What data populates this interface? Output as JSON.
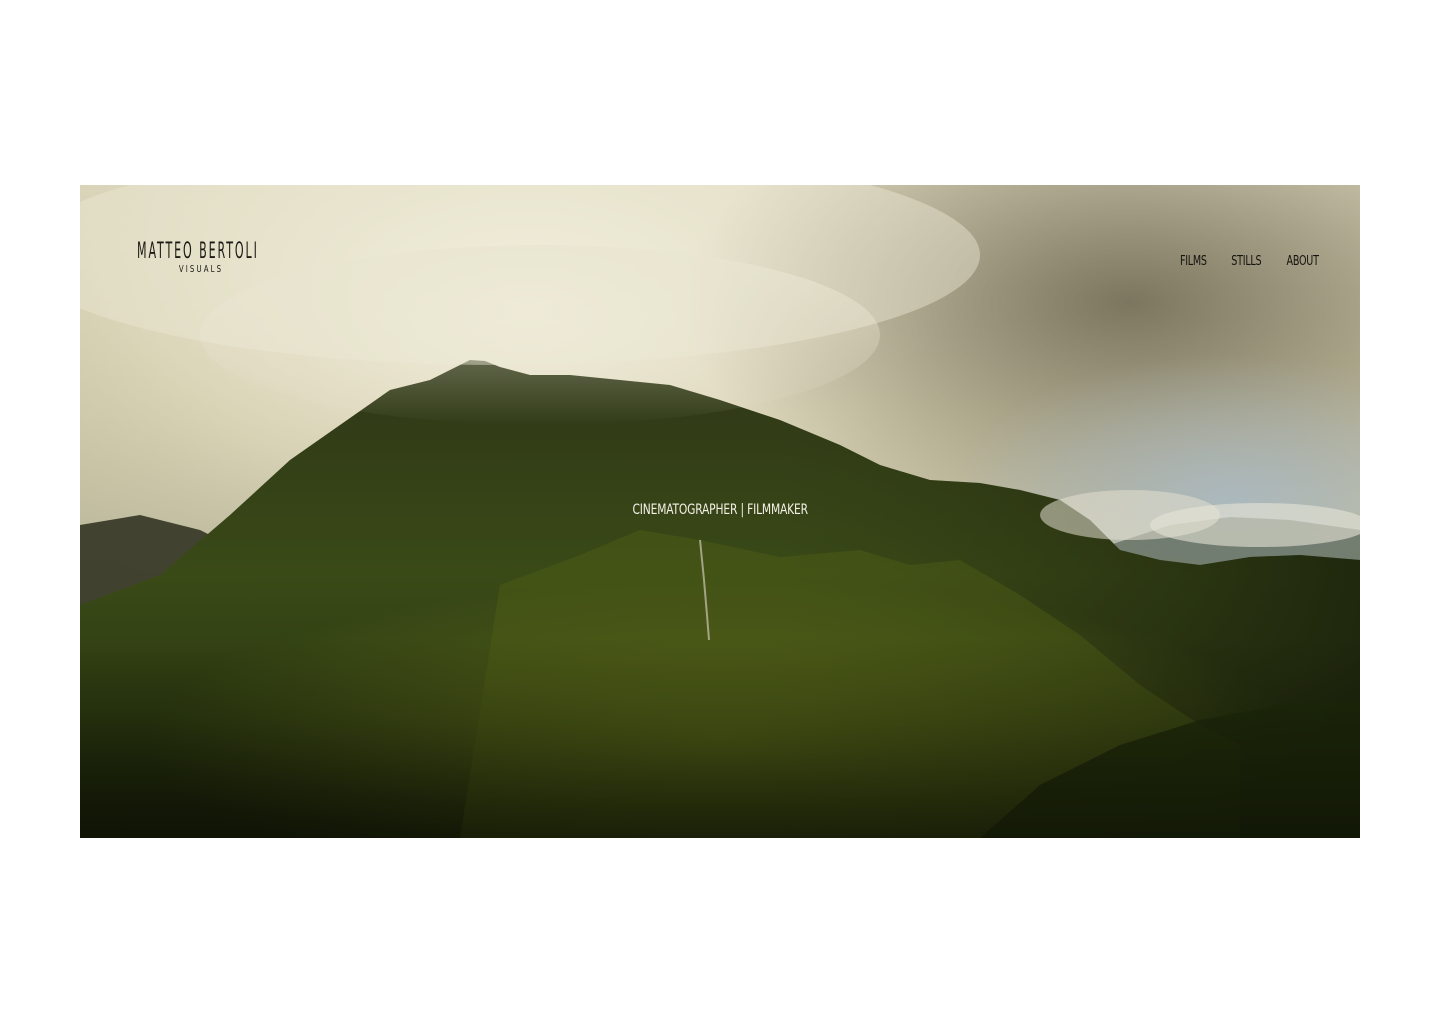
{
  "header": {
    "logo_name": "MATTEO BERTOLI",
    "logo_sub": "VISUALS"
  },
  "nav": {
    "items": [
      {
        "label": "FILMS"
      },
      {
        "label": "STILLS"
      },
      {
        "label": "ABOUT"
      }
    ]
  },
  "hero": {
    "tagline": "CINEMATOGRAPHER | FILMMAKER"
  },
  "colors": {
    "page_background": "#ffffff",
    "nav_text": "#15140f",
    "tagline_text": "#f4f1e6"
  }
}
